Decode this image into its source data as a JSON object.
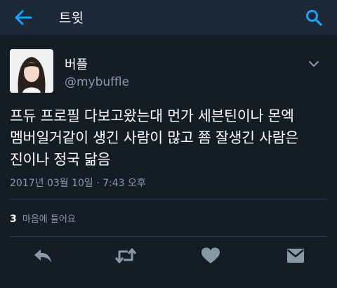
{
  "header": {
    "title": "트윗",
    "back_icon": "arrow-left-icon",
    "search_icon": "search-icon"
  },
  "tweet": {
    "display_name": "버플",
    "handle": "@mybuffle",
    "text_lines": [
      "프듀 프로필 다보고왔는대 먼가 세븐틴이나 몬엑",
      "멤버일거같이 생긴 사람이 많고 쬼 잘생긴 사람은",
      "진이나 정국 닮음"
    ],
    "timestamp": "2017년 03월 10일 · 7:43 오후",
    "likes_count": "3",
    "likes_label": "마음에 들어요"
  },
  "actions": [
    {
      "name": "reply-icon"
    },
    {
      "name": "retweet-icon"
    },
    {
      "name": "heart-icon"
    },
    {
      "name": "direct-message-icon"
    }
  ],
  "colors": {
    "background": "#141d26",
    "header_bg": "#1c2938",
    "accent": "#1da1f2",
    "secondary_text": "#8899a6",
    "icon_gray": "#8899a6"
  }
}
